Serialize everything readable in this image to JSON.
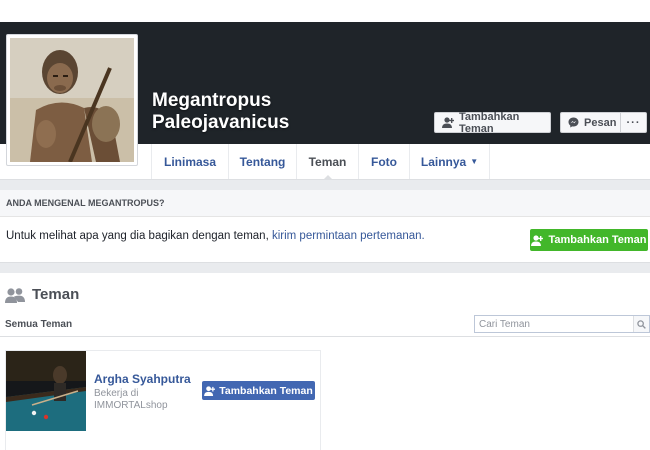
{
  "profile": {
    "name_line1": "Megantropus",
    "name_line2": "Paleojavanicus",
    "add_friend_label": "Tambahkan Teman",
    "message_label": "Pesan",
    "more_label": "···"
  },
  "tabs": [
    {
      "label": "Linimasa"
    },
    {
      "label": "Tentang"
    },
    {
      "label": "Teman",
      "active": true
    },
    {
      "label": "Foto"
    },
    {
      "label": "Lainnya",
      "icon": "caret-down-icon"
    }
  ],
  "know_prompt": {
    "header": "ANDA MENGENAL MEGANTROPUS?",
    "text": "Untuk melihat apa yang dia bagikan dengan teman,",
    "link": "kirim permintaan pertemanan.",
    "button_label": "Tambahkan Teman"
  },
  "friends": {
    "title": "Teman",
    "filter_label": "Semua Teman",
    "search_placeholder": "Cari Teman",
    "list": [
      {
        "name": "Argha Syahputra",
        "work_line1": "Bekerja di",
        "work_line2": "IMMORTALshop",
        "button_label": "Tambahkan Teman"
      }
    ]
  },
  "colors": {
    "cover_bg": "#1f2429",
    "link_blue": "#365899",
    "green_button": "#42b72a",
    "blue_button": "#4267b2"
  }
}
